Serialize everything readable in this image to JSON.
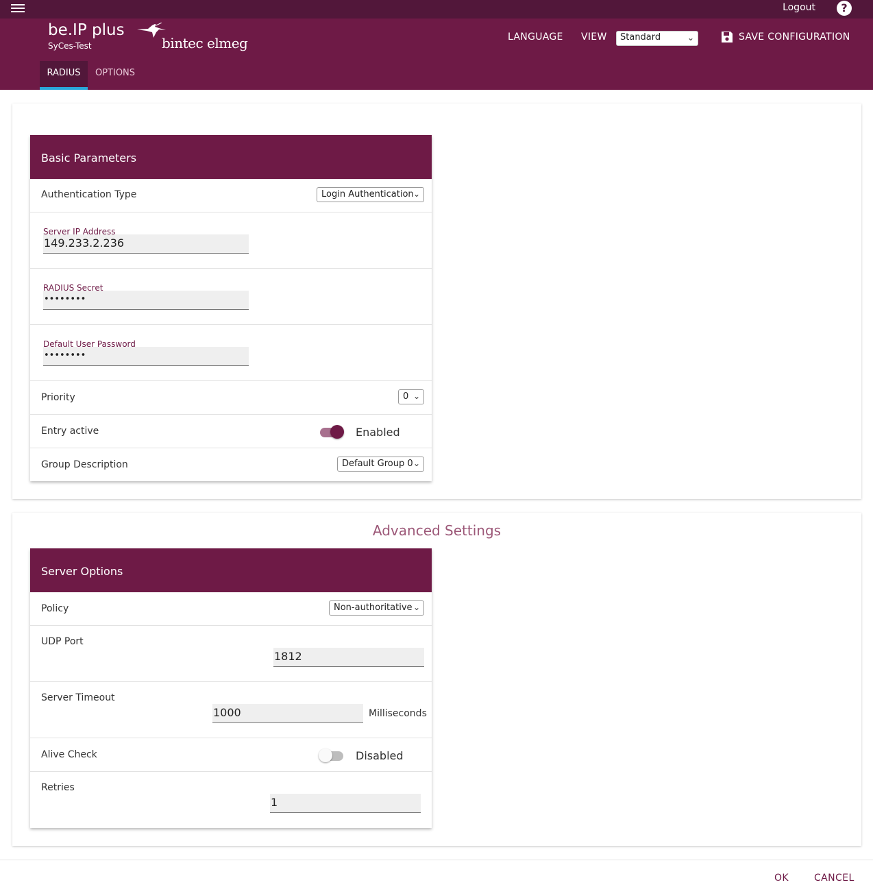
{
  "topbar": {
    "logout": "Logout",
    "help": "?"
  },
  "header": {
    "product": "be.IP plus",
    "device": "SyCes-Test",
    "brand": "bintec elmeg",
    "language": "LANGUAGE",
    "view_label": "VIEW",
    "view_value": "Standard",
    "save": "SAVE CONFIGURATION"
  },
  "tabs": [
    "RADIUS",
    "OPTIONS"
  ],
  "basic": {
    "title": "Basic Parameters",
    "auth_type_label": "Authentication Type",
    "auth_type_value": "Login Authentication",
    "server_ip_label": "Server IP Address",
    "server_ip_value": "149.233.2.236",
    "secret_label": "RADIUS Secret",
    "secret_value": "••••••••",
    "default_pw_label": "Default User Password",
    "default_pw_value": "••••••••",
    "priority_label": "Priority",
    "priority_value": "0",
    "entry_active_label": "Entry active",
    "entry_active_state": "Enabled",
    "group_label": "Group Description",
    "group_value": "Default Group 0"
  },
  "advanced": {
    "heading": "Advanced Settings",
    "title": "Server Options",
    "policy_label": "Policy",
    "policy_value": "Non-authoritative",
    "udp_label": "UDP Port",
    "udp_value": "1812",
    "timeout_label": "Server Timeout",
    "timeout_value": "1000",
    "timeout_unit": "Milliseconds",
    "alive_label": "Alive Check",
    "alive_state": "Disabled",
    "retries_label": "Retries",
    "retries_value": "1"
  },
  "footer": {
    "ok": "OK",
    "cancel": "CANCEL"
  },
  "colors": {
    "primary": "#6e1a46",
    "topbar": "#52173a",
    "tab_indicator": "#29a8d9",
    "heading": "#9c5878"
  },
  "icons": {
    "menu": "hamburger-icon",
    "help": "help-icon",
    "save": "floppy-disk-icon",
    "dropdown": "chevron-down-icon",
    "brand": "hummingbird-logo"
  }
}
